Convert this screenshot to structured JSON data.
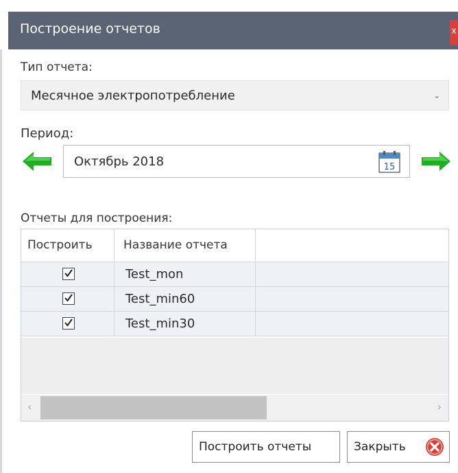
{
  "window": {
    "title": "Построение отчетов",
    "close_label": "x"
  },
  "report_type": {
    "label": "Тип отчета:",
    "value": "Месячное электропотребление"
  },
  "period": {
    "label": "Период:",
    "value": "Октябрь 2018",
    "calendar_day": "15"
  },
  "reports": {
    "label": "Отчеты для построения:",
    "columns": [
      "Построить",
      "Название отчета"
    ],
    "rows": [
      {
        "build": true,
        "name": "Test_mon"
      },
      {
        "build": true,
        "name": "Test_min60"
      },
      {
        "build": true,
        "name": "Test_min30"
      }
    ]
  },
  "buttons": {
    "build": "Построить отчеты",
    "close": "Закрыть"
  },
  "colors": {
    "titlebar": "#5b6475",
    "arrow_green": "#1fae1f",
    "close_red": "#d9403a"
  }
}
